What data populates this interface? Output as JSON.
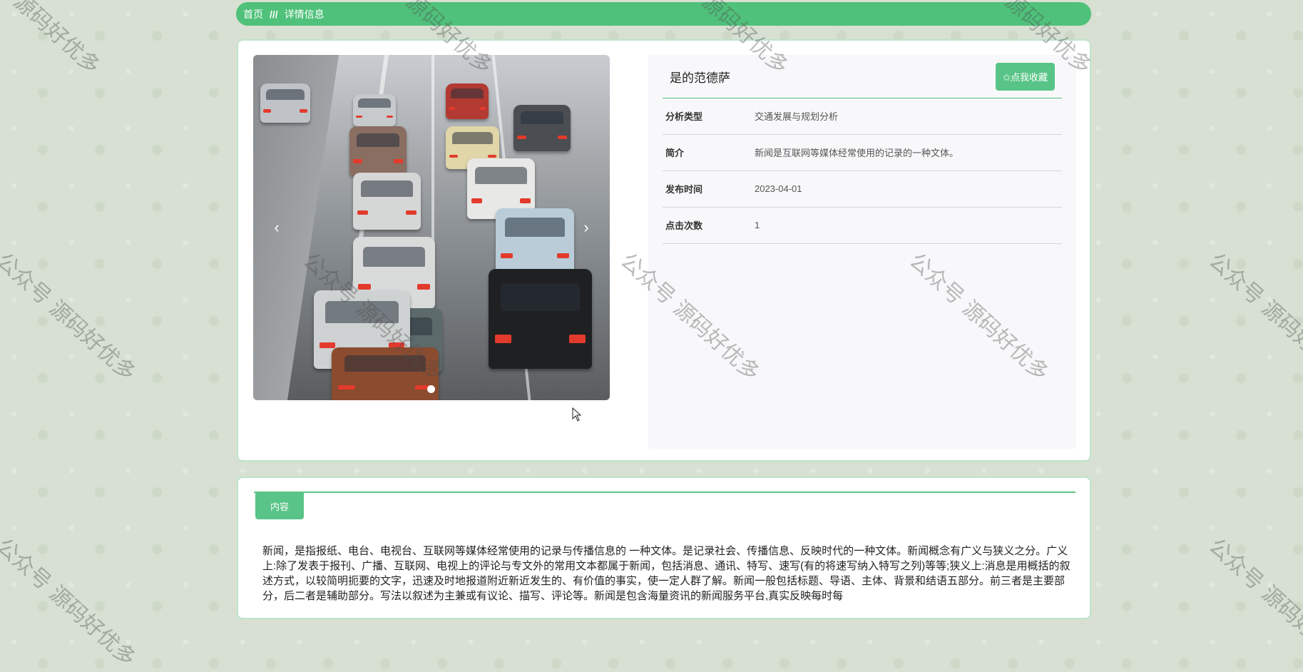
{
  "breadcrumb": {
    "home": "首页",
    "separator": "///",
    "current": "详情信息"
  },
  "detail": {
    "title": "是的范德萨",
    "favorite_label": "✩点我收藏",
    "rows": [
      {
        "key": "分析类型",
        "value": "交通发展与规划分析"
      },
      {
        "key": "简介",
        "value": "新闻是互联网等媒体经常使用的记录的一种文体。"
      },
      {
        "key": "发布时间",
        "value": "2023-04-01"
      },
      {
        "key": "点击次数",
        "value": "1"
      }
    ]
  },
  "carousel": {
    "prev": "‹",
    "next": "›"
  },
  "content": {
    "tab_label": "内容",
    "text": "新闻，是指报纸、电台、电视台、互联网等媒体经常使用的记录与传播信息的 一种文体。是记录社会、传播信息、反映时代的一种文体。新闻概念有广义与狭义之分。广义上:除了发表于报刊、广播、互联网、电视上的评论与专文外的常用文本都属于新闻，包括消息、通讯、特写、速写(有的将速写纳入特写之列)等等;狭义上:消息是用概括的叙述方式，以较简明扼要的文字，迅速及时地报道附近新近发生的、有价值的事实，使一定人群了解。新闻一般包括标题、导语、主体、背景和结语五部分。前三者是主要部分，后二者是辅助部分。写法以叙述为主兼或有议论、描写、评论等。新闻是包含海量资讯的新闻服务平台,真实反映每时每"
  },
  "watermark": {
    "text": "公众号 源码好优多"
  }
}
